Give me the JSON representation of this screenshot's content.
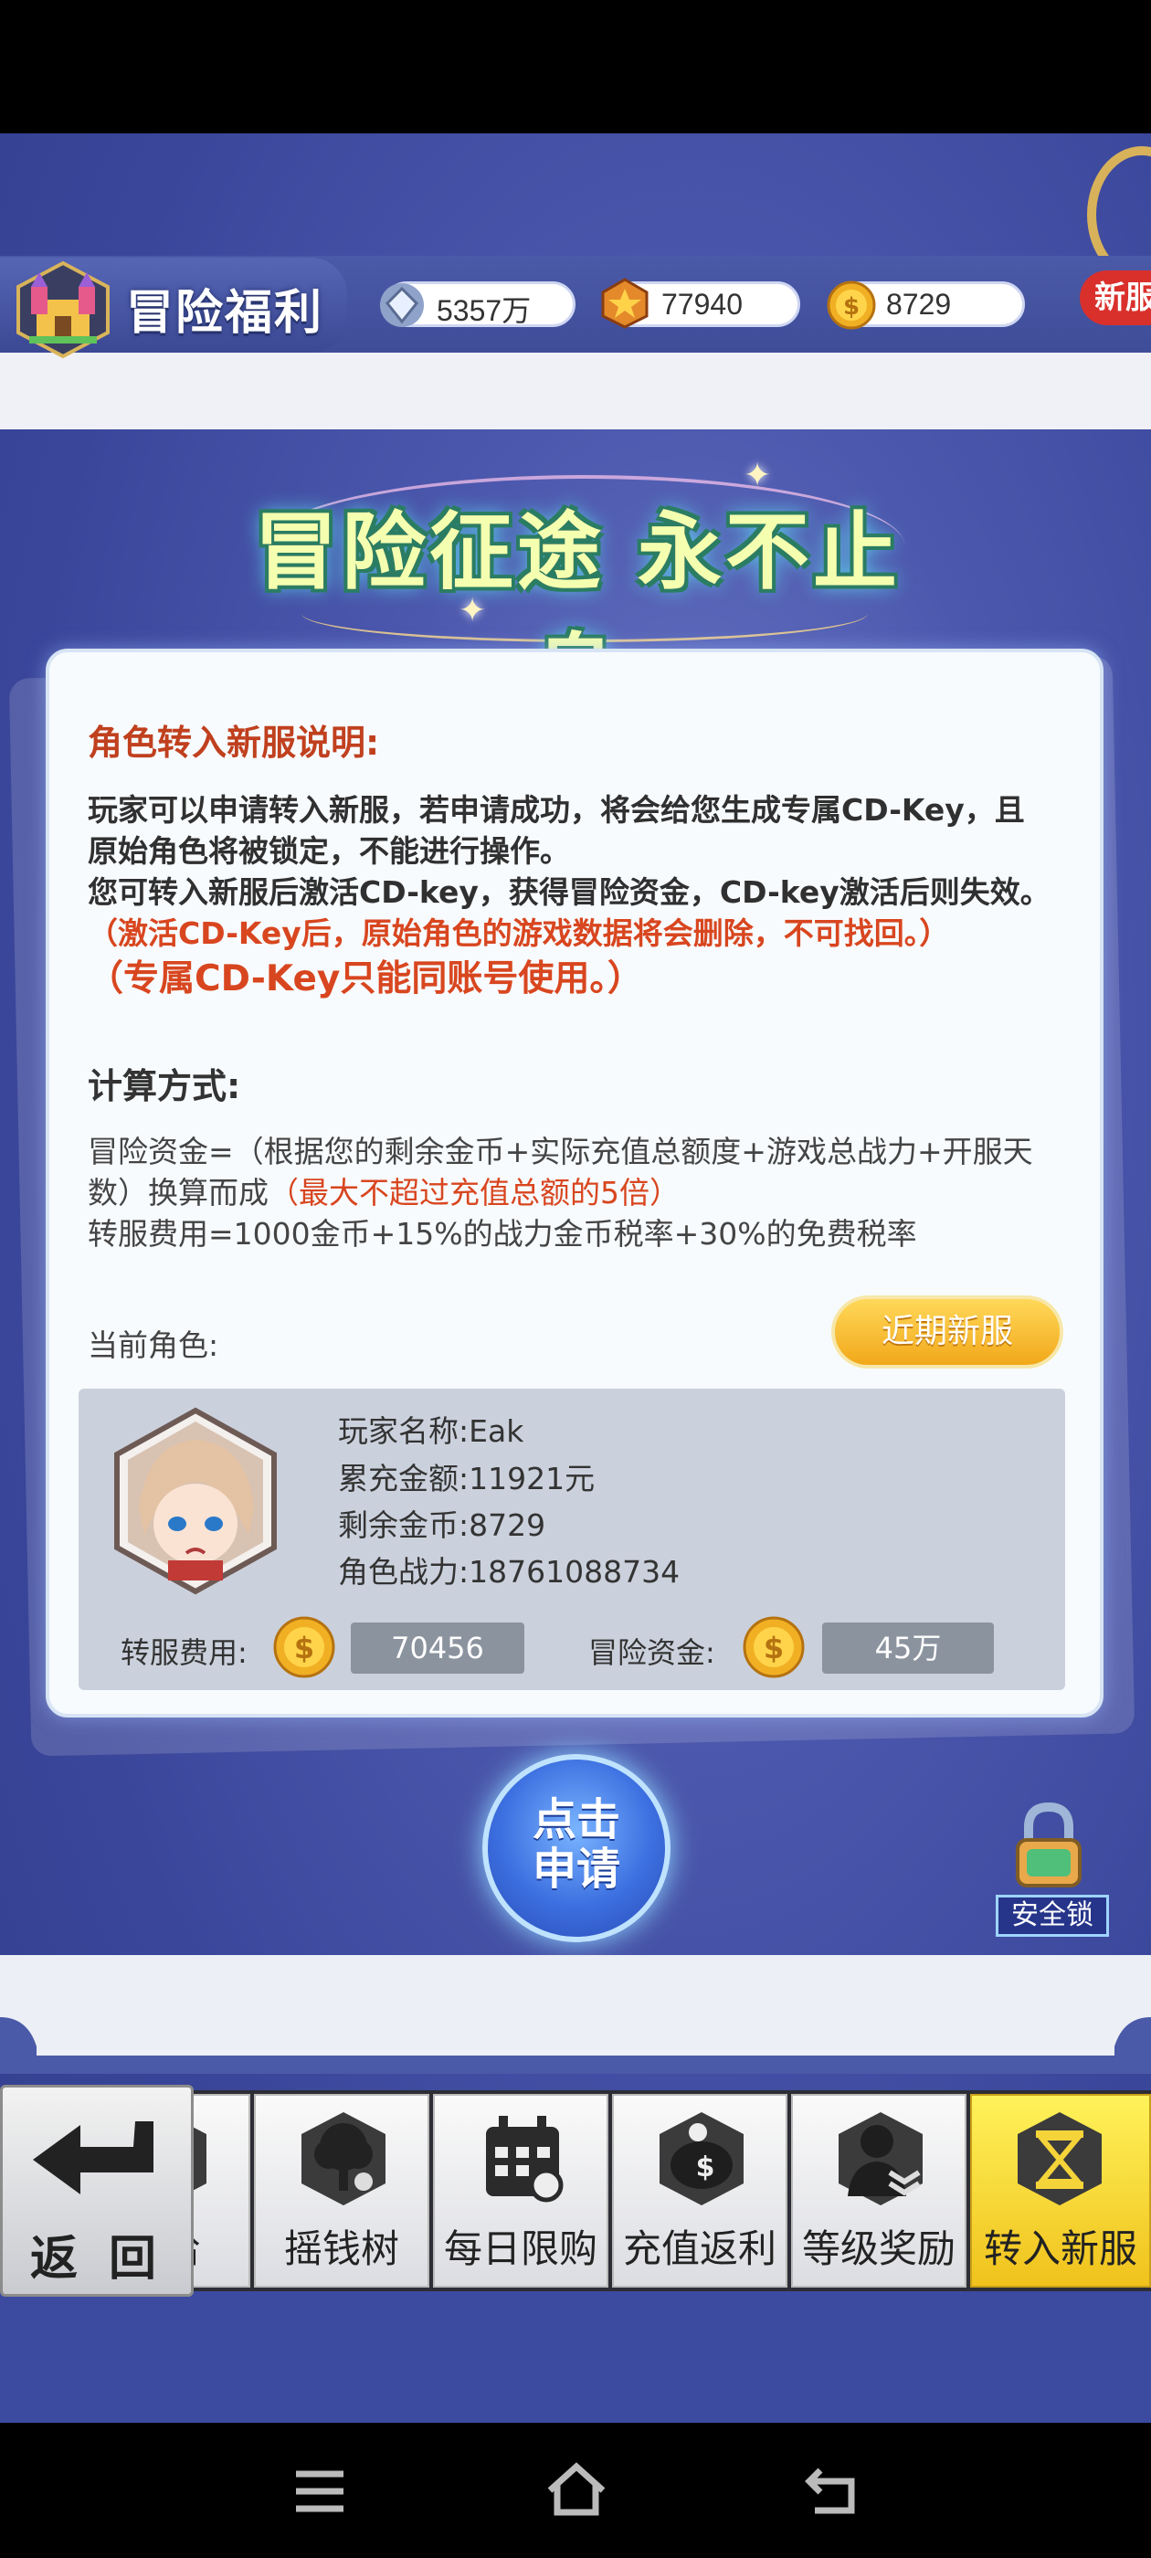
{
  "header": {
    "title": "冒险福利",
    "resources": [
      {
        "icon": "diamond-icon",
        "value": "5357万"
      },
      {
        "icon": "medal-icon",
        "value": "77940"
      },
      {
        "icon": "gold-coin-icon",
        "value": "8729"
      }
    ],
    "new_badge": "新服"
  },
  "banner": {
    "text": "冒险征途 永不止息"
  },
  "panel": {
    "heading": "角色转入新服说明:",
    "paragraph_lines": [
      "玩家可以申请转入新服，若申请成功，将会给您生成专属CD-Key，且",
      "原始角色将被锁定，不能进行操作。",
      "您可转入新服后激活CD-key，获得冒险资金，CD-key激活后则失效。"
    ],
    "warning_1": "（激活CD-Key后，原始角色的游戏数据将会删除，不可找回。）",
    "warning_2": "（专属CD-Key只能同账号使用。）",
    "calc_heading": "计算方式:",
    "calc_line1": "冒险资金=（根据您的剩余金币+实际充值总额度+游戏总战力+开服天",
    "calc_line2_prefix": "数）换算而成",
    "calc_line2_red": "（最大不超过充值总额的5倍）",
    "calc_line3": "转服费用=1000金币+15%的战力金币税率+30%的免费税率",
    "current_role_label": "当前角色:",
    "recent_server_button": "近期新服"
  },
  "character": {
    "name": "玩家名称:Eak",
    "total_recharge": "累充金额:11921元",
    "remaining_gold": "剩余金币:8729",
    "power": "角色战力:18761088734",
    "transfer_fee_label": "转服费用:",
    "transfer_fee_value": "70456",
    "adventure_fund_label": "冒险资金:",
    "adventure_fund_value": "45万"
  },
  "apply_button": {
    "line1": "点击",
    "line2": "申请"
  },
  "security_lock": "安全锁",
  "tabs": [
    {
      "label": "补给",
      "icon": "supply-icon",
      "active": false
    },
    {
      "label": "摇钱树",
      "icon": "money-tree-icon",
      "active": false
    },
    {
      "label": "每日限购",
      "icon": "calendar-icon",
      "active": false
    },
    {
      "label": "充值返利",
      "icon": "piggy-bank-icon",
      "active": false
    },
    {
      "label": "等级奖励",
      "icon": "rank-icon",
      "active": false
    },
    {
      "label": "转入新服",
      "icon": "hourglass-icon",
      "active": true
    }
  ],
  "back_button": "返 回",
  "colors": {
    "accent_gold": "#f2a81a",
    "warning_red": "#d8461f",
    "heading_red": "#c0401e",
    "active_tab": "#f0c21c"
  }
}
